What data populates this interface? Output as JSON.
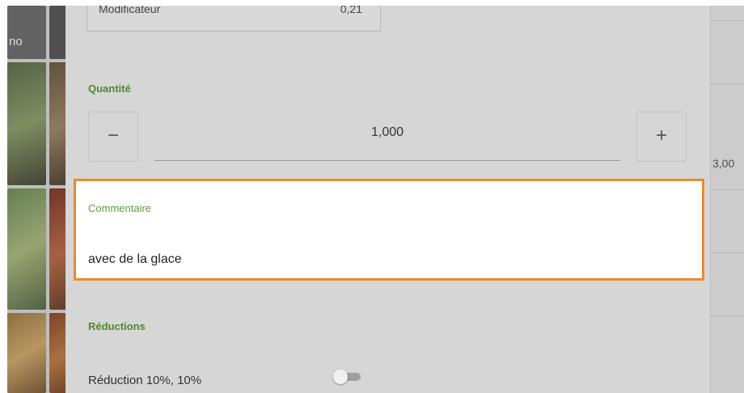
{
  "background": {
    "thumb_caption": "no",
    "right_value": "3,00"
  },
  "dialog": {
    "modifier": {
      "label": "Modificateur",
      "value": "0,21"
    },
    "quantity": {
      "label": "Quantité",
      "value": "1,000",
      "decrement_symbol": "−",
      "increment_symbol": "+"
    },
    "comment": {
      "label": "Commentaire",
      "value": "avec de la glace"
    },
    "reductions": {
      "label": "Réductions",
      "item_label": "Réduction 10%, 10%",
      "enabled": false
    }
  },
  "colors": {
    "section_label": "#4c8a2a",
    "highlight_border": "#ec8a32"
  }
}
